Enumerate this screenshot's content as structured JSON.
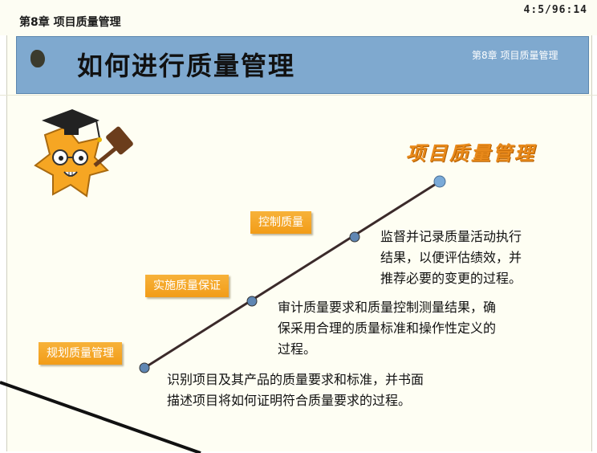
{
  "top": {
    "chapter": "第8章 项目质量管理",
    "timer": "4:5/96:14"
  },
  "header": {
    "title": "如何进行质量管理",
    "subtitle": "第8章 项目质量管理"
  },
  "brand": "项目质量管理",
  "steps": [
    {
      "label": "规划质量管理",
      "description_lines": [
        "识别项目及其产品的质量要求和标准，并书面",
        "描述项目将如何证明符合质量要求的过程。"
      ]
    },
    {
      "label": "实施质量保证",
      "description_lines": [
        "审计质量要求和质量控制测量结果，确",
        "保采用合理的质量标准和操作性定义的",
        "过程。"
      ]
    },
    {
      "label": "控制质量",
      "description_lines": [
        "监督并记录质量活动执行",
        "结果，以便评估绩效，并",
        "推荐必要的变更的过程。"
      ]
    }
  ],
  "mascot": {
    "icon": "star-mascot-with-graduation-cap-and-gavel-icon"
  },
  "colors": {
    "accent": "#f29c17",
    "header": "#7fa9cf",
    "line": "#3b2a2a",
    "node": "#5f86b3"
  }
}
